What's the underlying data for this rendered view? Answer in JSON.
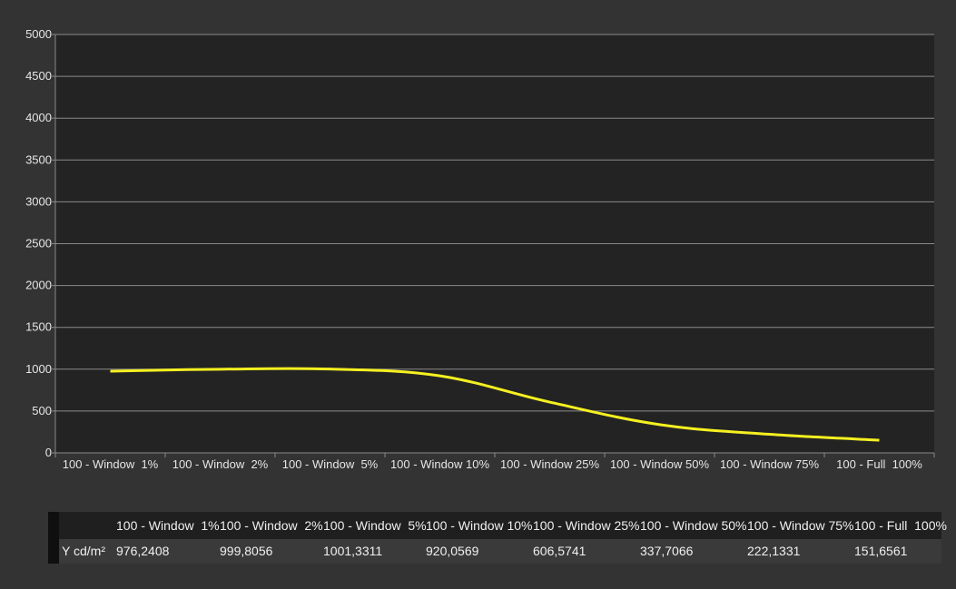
{
  "chart_data": {
    "type": "line",
    "categories": [
      "100 - Window  1%",
      "100 - Window  2%",
      "100 - Window  5%",
      "100 - Window 10%",
      "100 - Window 25%",
      "100 - Window 50%",
      "100 - Window 75%",
      "100 - Full  100%"
    ],
    "series": [
      {
        "values": [
          976.2408,
          999.8056,
          1001.3311,
          920.0569,
          606.5741,
          337.7066,
          222.1331,
          151.6561
        ]
      }
    ],
    "ylim": [
      0,
      5000
    ],
    "yticks": [
      0,
      500,
      1000,
      1500,
      2000,
      2500,
      3000,
      3500,
      4000,
      4500,
      5000
    ],
    "grid": true,
    "colors": {
      "line": "#f5f020",
      "plot_bg": "#232323",
      "grid": "#8a8a8a"
    }
  },
  "table": {
    "row_label": "Y cd/m²",
    "values": [
      "976,2408",
      "999,8056",
      "1001,3311",
      "920,0569",
      "606,5741",
      "337,7066",
      "222,1331",
      "151,6561"
    ]
  }
}
